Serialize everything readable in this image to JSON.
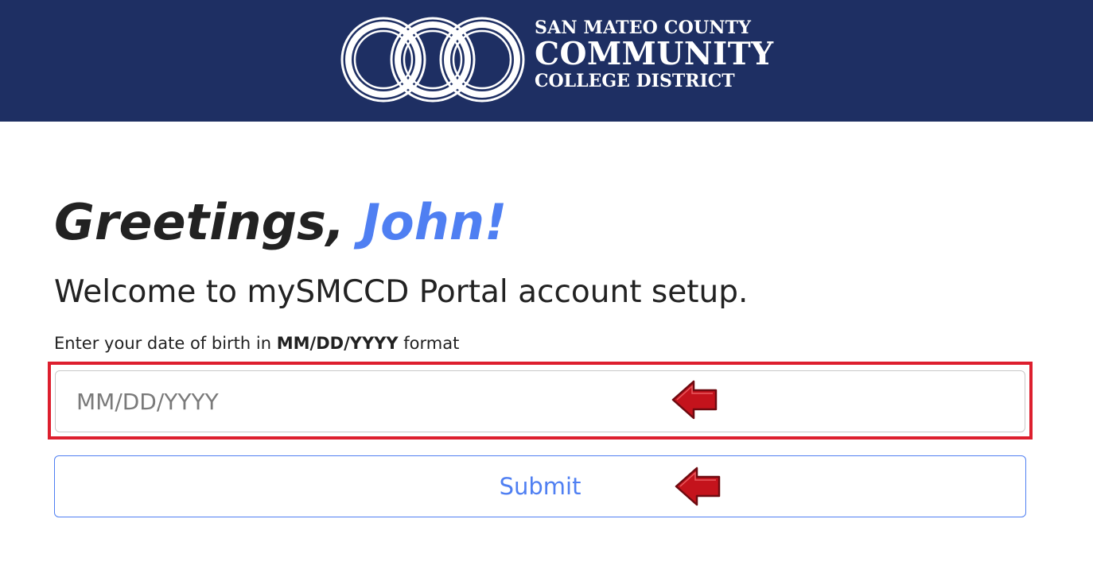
{
  "header": {
    "logo_line1": "SAN MATEO COUNTY",
    "logo_line2": "COMMUNITY",
    "logo_line3": "COLLEGE DISTRICT",
    "background_color": "#1e2f63"
  },
  "greeting": {
    "prefix": "Greetings,",
    "name": "John!"
  },
  "welcome_heading": "Welcome to mySMCCD Portal account setup.",
  "instruction": {
    "before": "Enter your date of birth in",
    "format": "MM/DD/YYYY",
    "after": "format"
  },
  "dob_field": {
    "placeholder": "MM/DD/YYYY",
    "value": ""
  },
  "submit_label": "Submit",
  "colors": {
    "accent": "#4f7ff2",
    "highlight": "#dd1f2e",
    "arrow": "#c4131c"
  },
  "annotations": {
    "arrow_icons": [
      "left-arrow-icon",
      "left-arrow-icon"
    ]
  }
}
